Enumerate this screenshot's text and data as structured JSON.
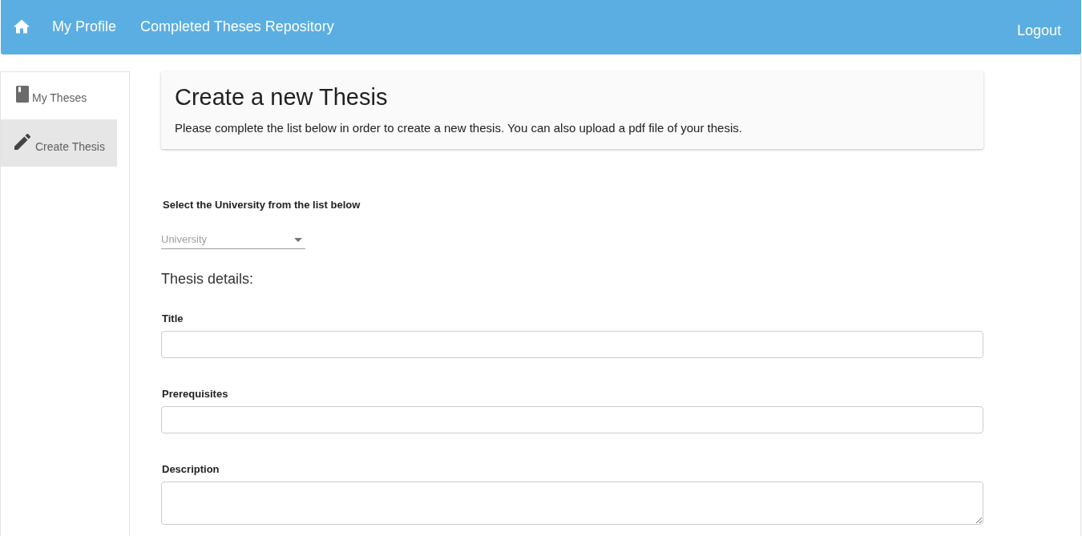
{
  "navbar": {
    "links": [
      {
        "label": "My Profile"
      },
      {
        "label": "Completed Theses Repository"
      }
    ],
    "logout": "Logout"
  },
  "sidebar": {
    "items": [
      {
        "label": "My Theses",
        "kind": "book",
        "selected": false
      },
      {
        "label": "Create Thesis",
        "kind": "pencil",
        "selected": true
      }
    ]
  },
  "header": {
    "title": "Create a new Thesis",
    "subtitle": "Please complete the list below in order to create a new thesis. You can also upload a pdf file of your thesis."
  },
  "university": {
    "label": "Select the University from the list below",
    "placeholder": "University"
  },
  "section_title": "Thesis details:",
  "fields": [
    {
      "label": "Title",
      "kind": "input"
    },
    {
      "label": "Prerequisites",
      "kind": "input"
    },
    {
      "label": "Description",
      "kind": "textarea"
    }
  ]
}
